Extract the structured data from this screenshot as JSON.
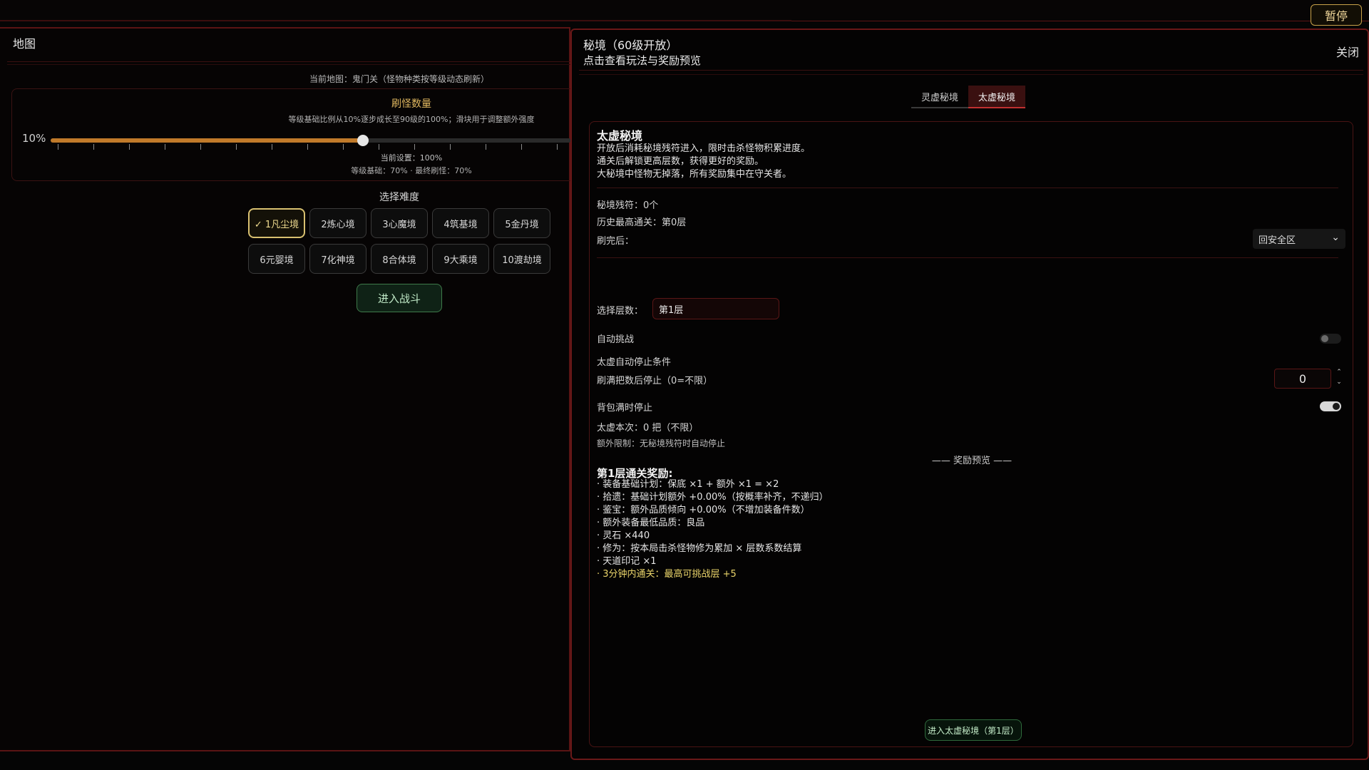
{
  "topbar": {
    "pause_label": "暂停"
  },
  "map_panel": {
    "title": "地图",
    "current_map": "当前地图：鬼门关（怪物种类按等级动态刷新）",
    "monster_count": {
      "title": "刷怪数量",
      "desc": "等级基础比例从10%逐步成长至90级的100%；滑块用于调整额外强度",
      "slider_label": "10%",
      "slider_value_percent": 100,
      "current_setting": "当前设置：100%",
      "base_text": "等级基础：70% · 最终刷怪：70%"
    },
    "difficulty": {
      "title": "选择难度",
      "options": [
        {
          "label": "✓ 1凡尘境",
          "selected": true
        },
        {
          "label": "2炼心境",
          "selected": false
        },
        {
          "label": "3心魔境",
          "selected": false
        },
        {
          "label": "4筑基境",
          "selected": false
        },
        {
          "label": "5金丹境",
          "selected": false
        },
        {
          "label": "6元婴境",
          "selected": false
        },
        {
          "label": "7化神境",
          "selected": false
        },
        {
          "label": "8合体境",
          "selected": false
        },
        {
          "label": "9大乘境",
          "selected": false
        },
        {
          "label": "10渡劫境",
          "selected": false
        }
      ]
    },
    "enter_battle_label": "进入战斗"
  },
  "modal": {
    "title": "秘境（60级开放）",
    "subtitle": "点击查看玩法与奖励预览",
    "close_label": "关闭",
    "tabs": [
      {
        "label": "灵虚秘境",
        "active": false
      },
      {
        "label": "太虚秘境",
        "active": true
      }
    ],
    "realm": {
      "name": "太虚秘境",
      "desc": [
        "开放后消耗秘境残符进入，限时击杀怪物积累进度。",
        "通关后解锁更高层数，获得更好的奖励。",
        "大秘境中怪物无掉落，所有奖励集中在守关者。"
      ],
      "runes": "秘境残符：0个",
      "best_clear": "历史最高通关：第0层",
      "after_clear_label": "刷完后：",
      "after_clear_value": "回安全区",
      "floor_label": "选择层数：",
      "floor_value": "第1层",
      "auto_challenge_label": "自动挑战",
      "auto_challenge_on": false,
      "auto_stop_title": "太虚自动停止条件",
      "stop_after_label": "刷满把数后停止（0=不限）",
      "stop_after_value": "0",
      "bag_full_label": "背包满时停止",
      "bag_full_on": true,
      "this_run": "太虚本次：0 把（不限）",
      "extra_limit": "额外限制：无秘境残符时自动停止",
      "reward_divider": "—— 奖励预览 ——",
      "reward_title": "第1层通关奖励:",
      "rewards": [
        "· 装备基础计划：保底 ×1 + 额外 ×1 = ×2",
        "· 拾遗：基础计划额外 +0.00%（按概率补齐，不递归）",
        "· 鉴宝：额外品质倾向 +0.00%（不增加装备件数）",
        "· 额外装备最低品质：良品",
        "· 灵石 ×440",
        "· 修为：按本局击杀怪物修为累加 × 层数系数结算",
        "· 天道印记 ×1"
      ],
      "reward_bonus": "· 3分钟内通关：最高可挑战层 +5",
      "enter_label": "进入太虚秘境（第1层）"
    }
  },
  "colors": {
    "accent_red": "#6a1818",
    "gold": "#e0b860",
    "cyan": "#4fd6c6",
    "green": "#3e7a4a"
  }
}
